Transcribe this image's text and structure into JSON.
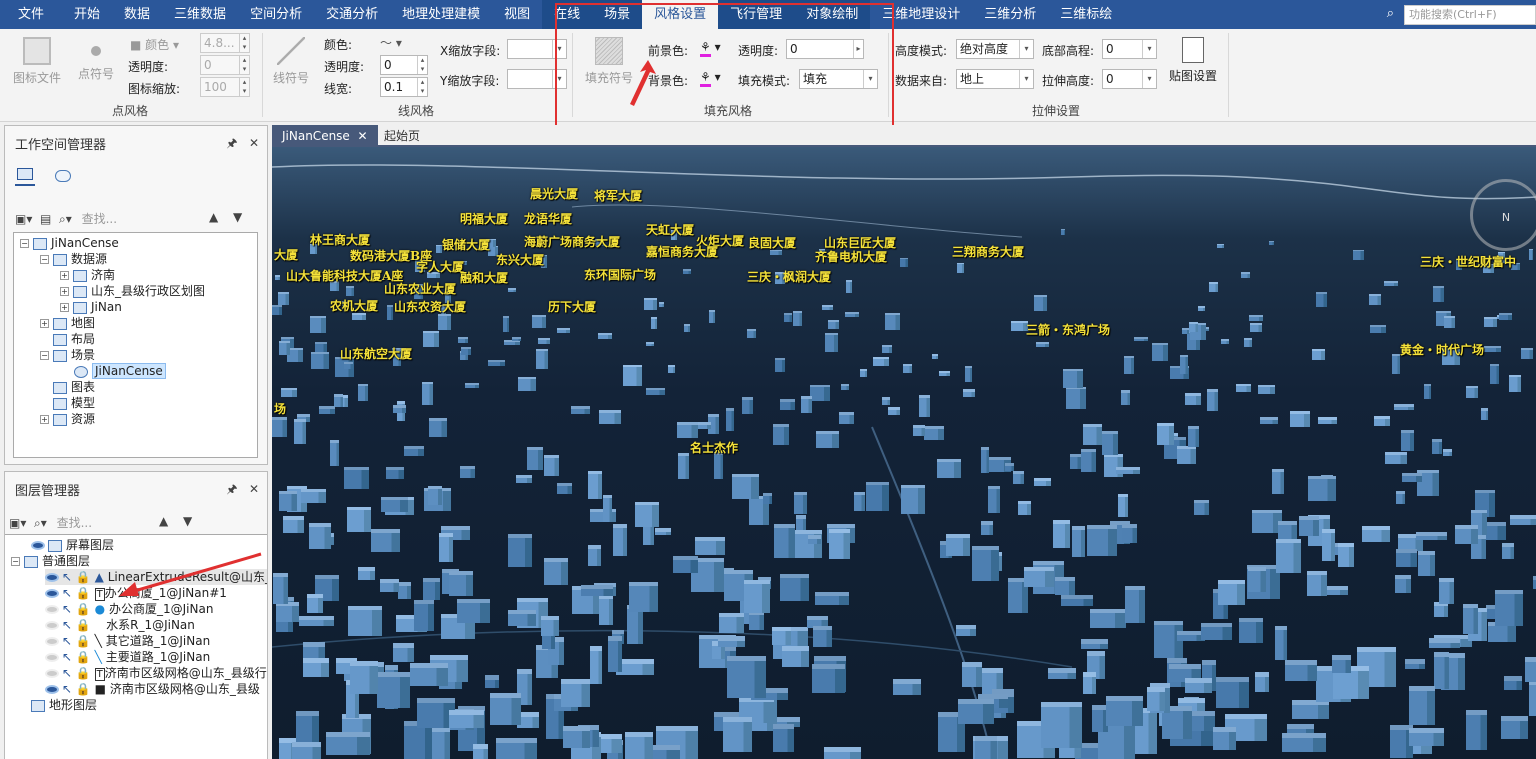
{
  "menubar": {
    "items": [
      "文件",
      "开始",
      "数据",
      "三维数据",
      "空间分析",
      "交通分析",
      "地理处理建模",
      "视图",
      "在线",
      "场景",
      "风格设置",
      "飞行管理",
      "对象绘制",
      "三维地理设计",
      "三维分析",
      "三维标绘"
    ],
    "search_placeholder": "功能搜索(Ctrl+F)",
    "accent": "#2b579a"
  },
  "ribbon": {
    "point_style": {
      "icon_file": "图标文件",
      "point_symbol": "点符号",
      "color": "颜色",
      "opacity": "透明度:",
      "opacity_value": "0",
      "icon_scale": "图标缩放:",
      "icon_scale_value": "100",
      "size_value": "4.8...",
      "group_label": "点风格"
    },
    "line_style": {
      "line_symbol": "线符号",
      "color": "颜色:",
      "opacity": "透明度:",
      "opacity_value": "0",
      "width": "线宽:",
      "width_value": "0.1",
      "x_scale": "X缩放字段:",
      "y_scale": "Y缩放字段:",
      "group_label": "线风格"
    },
    "fill_style": {
      "fill_symbol": "填充符号",
      "foreground": "前景色:",
      "background": "背景色:",
      "opacity": "透明度:",
      "opacity_value": "0",
      "fill_mode": "填充模式:",
      "fill_mode_value": "填充",
      "group_label": "填充风格"
    },
    "extrude": {
      "height_mode": "高度模式:",
      "height_mode_value": "绝对高度",
      "data_from": "数据来自:",
      "data_from_value": "地上",
      "base_height": "底部高程:",
      "base_height_value": "0",
      "extrude_height": "拉伸高度:",
      "extrude_height_value": "0",
      "texture": "贴图设置",
      "group_label": "拉伸设置"
    },
    "highlight_color": "#e03030"
  },
  "workspace": {
    "title": "工作空间管理器",
    "search_placeholder": "查找...",
    "tree": {
      "root": "JiNanCense",
      "datasource": "数据源",
      "ds1": "济南",
      "ds2": "山东_县级行政区划图",
      "ds3": "JiNan",
      "maps": "地图",
      "layouts": "布局",
      "scenes": "场景",
      "scene1": "JiNanCense",
      "charts": "图表",
      "models": "模型",
      "resources": "资源"
    }
  },
  "layers": {
    "title": "图层管理器",
    "search_placeholder": "查找...",
    "screen_layer": "屏幕图层",
    "normal_layer": "普通图层",
    "terrain_layer": "地形图层",
    "items": [
      "LinearExtrudeResult@山东_县",
      "办公商厦_1@JiNan#1",
      "办公商厦_1@JiNan",
      "水系R_1@JiNan",
      "其它道路_1@JiNan",
      "主要道路_1@JiNan",
      "济南市区级网格@山东_县级行政",
      "济南市区级网格@山东_县级"
    ]
  },
  "doc_tabs": {
    "active": "JiNanCense",
    "other": "起始页"
  },
  "scene": {
    "compass": "N",
    "labels": [
      "晨光大厦",
      "将军大厦",
      "明福大厦",
      "龙语华厦",
      "天虹大厦",
      "林王商大厦",
      "海蔚广场商务大厦",
      "火炬大厦",
      "良固大厦",
      "山东巨匠大厦",
      "大厦",
      "银储大厦",
      "嘉恒商务大厦",
      "齐鲁电机大厦",
      "三翔商务大厦",
      "数码港大厦B座",
      "字人大厦",
      "东兴大厦",
      "东环国际广场",
      "三庆・枫润大厦",
      "三庆・世纪财富中",
      "山大鲁能科技大厦A座",
      "融和大厦",
      "山东农业大厦",
      "农机大厦",
      "山东农资大厦",
      "历下大厦",
      "三箭・东鸿广场",
      "山东航空大厦",
      "黄金・时代广场",
      "名士杰作",
      "场"
    ]
  }
}
